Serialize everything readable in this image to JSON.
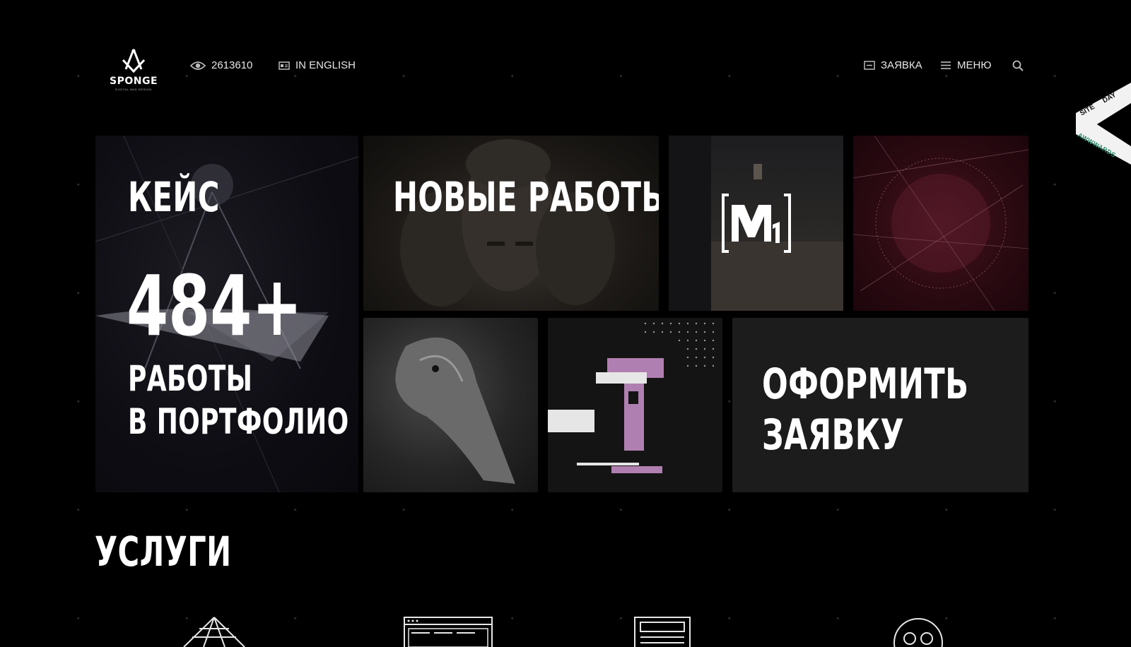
{
  "header": {
    "logo": {
      "name": "SPONGE",
      "tagline": "DIGITAL AND DESIGN"
    },
    "views_count": "2613610",
    "language_link": "IN ENGLISH",
    "order_link": "ЗАЯВКА",
    "menu_link": "МЕНЮ"
  },
  "award": {
    "line1": "SITE",
    "line2": "DAY",
    "brand": "AWWWARDS"
  },
  "tiles": {
    "case": {
      "title": "КЕЙС",
      "number": "484+",
      "subtitle_line1": "РАБОТЫ",
      "subtitle_line2": "В ПОРТФОЛИО"
    },
    "new_works": {
      "title": "НОВЫЕ РАБОТЫ"
    },
    "m1": {
      "logo_text": "M1"
    },
    "apply": {
      "line1": "ОФОРМИТЬ",
      "line2": "ЗАЯВКУ"
    }
  },
  "services": {
    "title": "УСЛУГИ",
    "icons": [
      "diamond-icon",
      "browser-window-icon",
      "document-layout-icon",
      "mascot-face-icon"
    ]
  },
  "colors": {
    "background": "#000000",
    "tile_dark": "#1c1c1c",
    "accent_pink": "#b07fb1",
    "accent_red": "#4a1420"
  }
}
